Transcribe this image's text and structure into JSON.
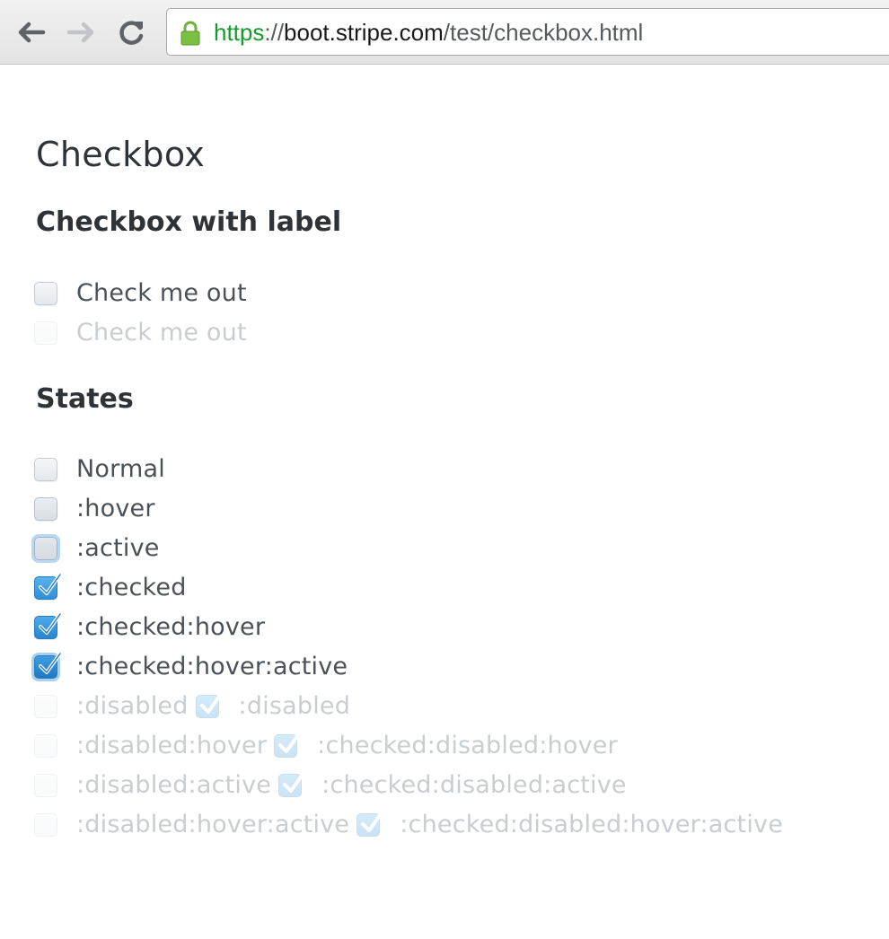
{
  "browser": {
    "url_scheme": "https",
    "url_separator": "://",
    "url_host": "boot.stripe.com",
    "url_path": "/test/checkbox.html"
  },
  "page": {
    "title": "Checkbox",
    "section_label": "Checkbox with label",
    "section_states": "States"
  },
  "label_rows": [
    {
      "label": "Check me out",
      "disabled": false
    },
    {
      "label": "Check me out",
      "disabled": true
    }
  ],
  "states": {
    "normal": ":hover",
    "normal_label": "Normal",
    "hover_label": ":hover",
    "active_label": ":active",
    "checked_label": ":checked",
    "checked_hover_label": ":checked:hover",
    "checked_hover_active_label": ":checked:hover:active",
    "disabled_label": ":disabled",
    "checked_disabled_label": ":disabled",
    "disabled_hover_label": ":disabled:hover",
    "checked_disabled_hover_label": ":checked:disabled:hover",
    "disabled_active_label": ":disabled:active",
    "checked_disabled_active_label": ":checked:disabled:active",
    "disabled_hover_active_label": ":disabled:hover:active",
    "checked_disabled_hover_active_label": ":checked:disabled:hover:active"
  },
  "colors": {
    "url_scheme": "#159b2b",
    "checked_fill": "#3a9be2",
    "active_ring": "#b8d8f3",
    "text": "#2e3338"
  }
}
